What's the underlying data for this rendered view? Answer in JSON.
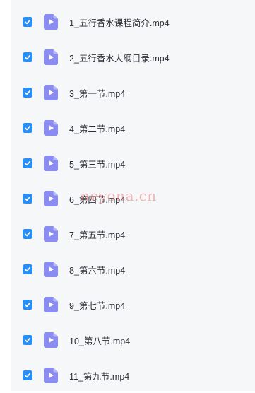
{
  "files": [
    {
      "name": "1_五行香水课程简介.mp4",
      "checked": true
    },
    {
      "name": "2_五行香水大纲目录.mp4",
      "checked": true
    },
    {
      "name": "3_第一节.mp4",
      "checked": true
    },
    {
      "name": "4_第二节.mp4",
      "checked": true
    },
    {
      "name": "5_第三节.mp4",
      "checked": true
    },
    {
      "name": "6_第四节.mp4",
      "checked": true
    },
    {
      "name": "7_第五节.mp4",
      "checked": true
    },
    {
      "name": "8_第六节.mp4",
      "checked": true
    },
    {
      "name": "9_第七节.mp4",
      "checked": true
    },
    {
      "name": "10_第八节.mp4",
      "checked": true
    },
    {
      "name": "11_第九节.mp4",
      "checked": true
    }
  ],
  "icons": {
    "checkbox": "checkbox-checked-icon",
    "file": "video-file-icon"
  },
  "colors": {
    "checkbox": "#2a8ff5",
    "file_icon": "#8b8cf2",
    "panel_background": "#f6f7f9",
    "watermark": "#eb7878"
  },
  "watermark": "neyona.cn"
}
